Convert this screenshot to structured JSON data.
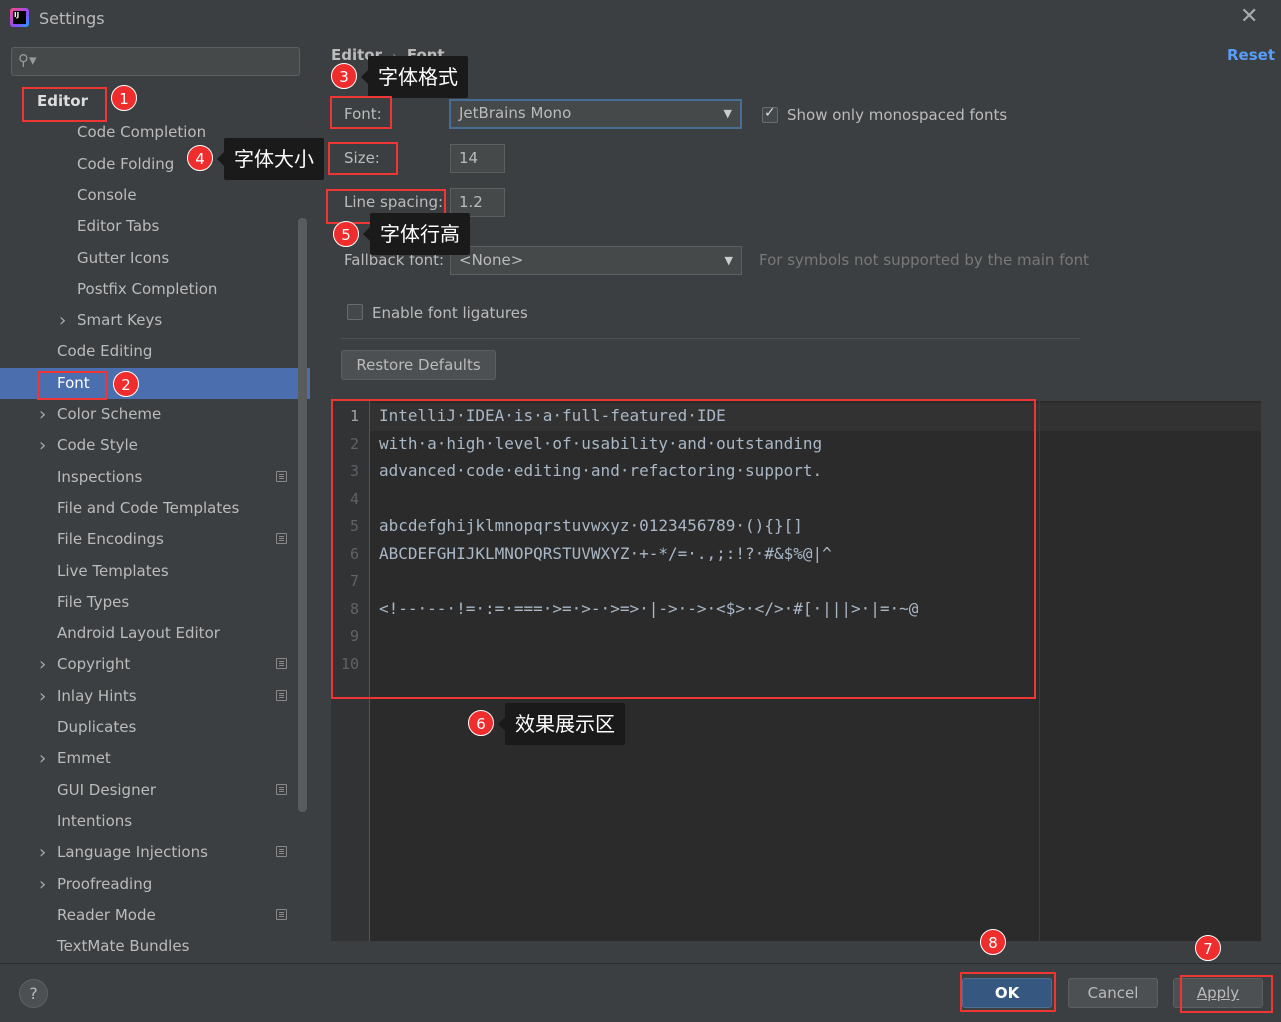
{
  "window": {
    "title": "Settings",
    "app_icon_text": "IJ"
  },
  "sidebar": {
    "search_placeholder": "",
    "items": [
      {
        "label": "Editor",
        "level": 0,
        "bold": true
      },
      {
        "label": "Code Completion",
        "level": 2
      },
      {
        "label": "Code Folding",
        "level": 2
      },
      {
        "label": "Console",
        "level": 2
      },
      {
        "label": "Editor Tabs",
        "level": 2
      },
      {
        "label": "Gutter Icons",
        "level": 2
      },
      {
        "label": "Postfix Completion",
        "level": 2
      },
      {
        "label": "Smart Keys",
        "level": 2,
        "expandable": true
      },
      {
        "label": "Code Editing",
        "level": 1
      },
      {
        "label": "Font",
        "level": 1,
        "selected": true
      },
      {
        "label": "Color Scheme",
        "level": 1,
        "expandable": true
      },
      {
        "label": "Code Style",
        "level": 1,
        "expandable": true
      },
      {
        "label": "Inspections",
        "level": 1,
        "project": true
      },
      {
        "label": "File and Code Templates",
        "level": 1
      },
      {
        "label": "File Encodings",
        "level": 1,
        "project": true
      },
      {
        "label": "Live Templates",
        "level": 1
      },
      {
        "label": "File Types",
        "level": 1
      },
      {
        "label": "Android Layout Editor",
        "level": 1
      },
      {
        "label": "Copyright",
        "level": 1,
        "expandable": true,
        "project": true
      },
      {
        "label": "Inlay Hints",
        "level": 1,
        "expandable": true,
        "project": true
      },
      {
        "label": "Duplicates",
        "level": 1
      },
      {
        "label": "Emmet",
        "level": 1,
        "expandable": true
      },
      {
        "label": "GUI Designer",
        "level": 1,
        "project": true
      },
      {
        "label": "Intentions",
        "level": 1
      },
      {
        "label": "Language Injections",
        "level": 1,
        "expandable": true,
        "project": true
      },
      {
        "label": "Proofreading",
        "level": 1,
        "expandable": true
      },
      {
        "label": "Reader Mode",
        "level": 1,
        "project": true
      },
      {
        "label": "TextMate Bundles",
        "level": 1
      }
    ]
  },
  "breadcrumb": {
    "parent": "Editor",
    "current": "Font"
  },
  "reset_label": "Reset",
  "form": {
    "font_label": "Font:",
    "font_value": "JetBrains Mono",
    "mono_only_label": "Show only monospaced fonts",
    "mono_only_checked": true,
    "size_label": "Size:",
    "size_value": "14",
    "line_spacing_label": "Line spacing:",
    "line_spacing_value": "1.2",
    "fallback_label": "Fallback font:",
    "fallback_value": "<None>",
    "fallback_hint": "For symbols not supported by the main font",
    "ligatures_label": "Enable font ligatures",
    "ligatures_checked": false,
    "restore_label": "Restore Defaults"
  },
  "preview": {
    "line_numbers": [
      "1",
      "2",
      "3",
      "4",
      "5",
      "6",
      "7",
      "8",
      "9",
      "10"
    ],
    "lines": [
      "IntelliJ·IDEA·is·a·full-featured·IDE",
      "with·a·high·level·of·usability·and·outstanding",
      "advanced·code·editing·and·refactoring·support.",
      "",
      "abcdefghijklmnopqrstuvwxyz·0123456789·(){}[]",
      "ABCDEFGHIJKLMNOPQRSTUVWXYZ·+-*/=·.,;:!?·#&$%@|^",
      "",
      "<!--·--·!=·:=·===·>=·>-·>=>·|->·->·<$>·</>·#[·|||>·|=·~@",
      "",
      ""
    ]
  },
  "buttons": {
    "help": "?",
    "ok": "OK",
    "cancel": "Cancel",
    "apply": "Apply"
  },
  "annotations": {
    "n1": "1",
    "n2": "2",
    "n3": "3",
    "n4": "4",
    "n5": "5",
    "n6": "6",
    "n7": "7",
    "n8": "8",
    "c3": "字体格式",
    "c4": "字体大小",
    "c5": "字体行高",
    "c6": "效果展示区"
  },
  "colors": {
    "accent": "#4b6eaf",
    "annotation_red": "#f03535",
    "background": "#3c3f41",
    "editor_bg": "#2b2b2b"
  }
}
